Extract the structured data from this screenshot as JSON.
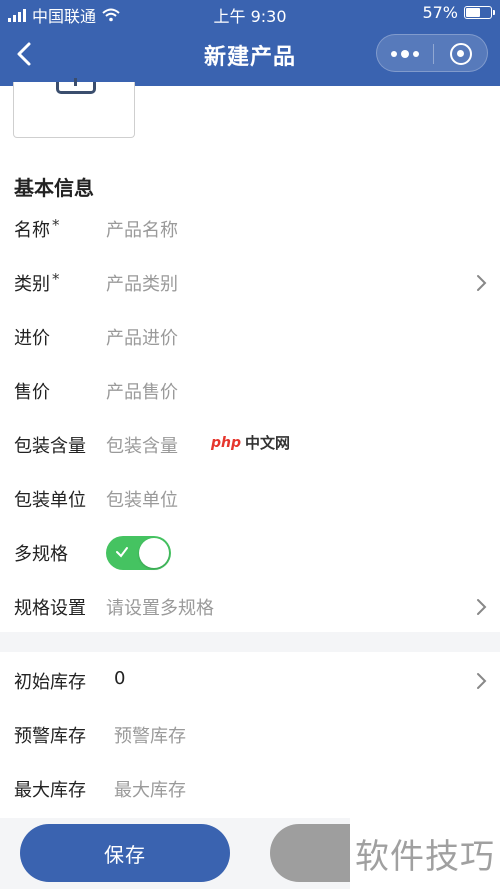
{
  "status_bar": {
    "carrier": "中国联通",
    "time": "上午 9:30",
    "battery": "57%",
    "battery_level": 0.57
  },
  "nav": {
    "title": "新建产品"
  },
  "form": {
    "section_title": "基本信息",
    "name": {
      "label": "名称",
      "required_mark": "*",
      "placeholder": "产品名称"
    },
    "category": {
      "label": "类别",
      "required_mark": "*",
      "placeholder": "产品类别"
    },
    "purchase_price": {
      "label": "进价",
      "placeholder": "产品进价"
    },
    "sale_price": {
      "label": "售价",
      "placeholder": "产品售价"
    },
    "package_qty": {
      "label": "包装含量",
      "placeholder": "包装含量"
    },
    "package_unit": {
      "label": "包装单位",
      "placeholder": "包装单位"
    },
    "multi_spec": {
      "label": "多规格",
      "enabled": true
    },
    "spec_settings": {
      "label": "规格设置",
      "placeholder": "请设置多规格"
    }
  },
  "stock": {
    "initial": {
      "label": "初始库存",
      "value": "0"
    },
    "warning": {
      "label": "预警库存",
      "placeholder": "预警库存"
    },
    "max": {
      "label": "最大库存",
      "placeholder": "最大库存"
    }
  },
  "actions": {
    "save_label": "保存"
  },
  "watermarks": {
    "php_logo": "php",
    "php_site": "中文网",
    "tips": "软件技巧"
  },
  "colors": {
    "primary": "#3a63b0",
    "toggle_on": "#45c361",
    "placeholder": "#9a9a9a"
  }
}
